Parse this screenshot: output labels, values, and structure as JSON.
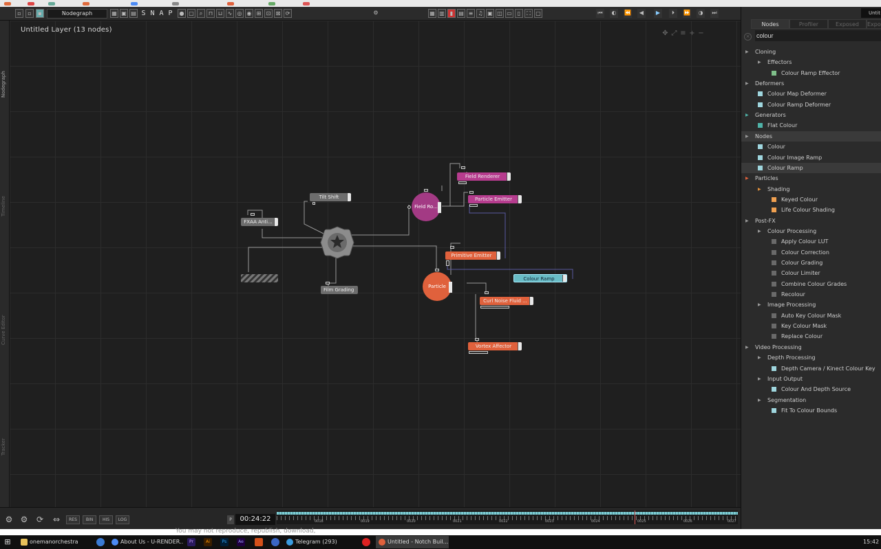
{
  "toolbar": {
    "panel_name": "Nodegraph",
    "snap_letters": [
      "S",
      "N",
      "A",
      "P"
    ]
  },
  "sidebar_tabs": {
    "nodegraph": "Nodegraph",
    "timeline": "Timeline",
    "curve_editor": "Curve Editor",
    "tracker": "Tracker"
  },
  "canvas": {
    "layer_title": "Untitled  Layer  (13  nodes)",
    "view_controls": [
      "move-icon",
      "fit-icon",
      "align-icon",
      "zoom-in-icon",
      "zoom-out-icon"
    ]
  },
  "nodes": {
    "tilt_shift": "Tilt  Shift",
    "fxaa": "FXAA  Anti...",
    "film_grading": "Film  Grading",
    "field_renderer": "Field  Renderer",
    "particle_emitter": "Particle  Emitter",
    "field_root": "Field  Ro...",
    "primitive_emitter": "Primitive  Emitter",
    "colour_ramp": "Colour  Ramp",
    "particle_root": "Particle",
    "curl_noise": "Curl  Noise  Fluid  ...",
    "vortex": "Vortex  Affector"
  },
  "right_panel": {
    "window_label": "Untit",
    "tabs": [
      "Nodes",
      "Profiler",
      "Exposed",
      "Exposed"
    ],
    "search_value": "colour",
    "tree": [
      {
        "label": "Cloning",
        "level": 0,
        "type": "group",
        "arrow_color": "#9a9a9a"
      },
      {
        "label": "Effectors",
        "level": 1,
        "type": "group",
        "arrow_color": "#9a9a9a"
      },
      {
        "label": "Colour Ramp Effector",
        "level": 2,
        "type": "item",
        "color": "#7fbf8a"
      },
      {
        "label": "Deformers",
        "level": 0,
        "type": "group",
        "arrow_color": "#9a9a9a"
      },
      {
        "label": "Colour Map Deformer",
        "level": 1,
        "type": "item",
        "color": "#9fd6de"
      },
      {
        "label": "Colour Ramp Deformer",
        "level": 1,
        "type": "item",
        "color": "#9fd6de"
      },
      {
        "label": "Generators",
        "level": 0,
        "type": "group",
        "arrow_color": "#4fb3a8"
      },
      {
        "label": "Flat Colour",
        "level": 1,
        "type": "item",
        "color": "#4fb3a8"
      },
      {
        "label": "Nodes",
        "level": 0,
        "type": "group",
        "arrow_color": "#9a9a9a",
        "selected": true
      },
      {
        "label": "Colour",
        "level": 1,
        "type": "item",
        "color": "#9fd6de"
      },
      {
        "label": "Colour Image Ramp",
        "level": 1,
        "type": "item",
        "color": "#9fd6de"
      },
      {
        "label": "Colour Ramp",
        "level": 1,
        "type": "item",
        "color": "#9fd6de",
        "selected": true
      },
      {
        "label": "Particles",
        "level": 0,
        "type": "group",
        "arrow_color": "#e0613c"
      },
      {
        "label": "Shading",
        "level": 1,
        "type": "group",
        "arrow_color": "#e0903c"
      },
      {
        "label": "Keyed Colour",
        "level": 2,
        "type": "item",
        "color": "#f0a050"
      },
      {
        "label": "Life Colour Shading",
        "level": 2,
        "type": "item",
        "color": "#f0a050"
      },
      {
        "label": "Post-FX",
        "level": 0,
        "type": "group",
        "arrow_color": "#9a9a9a"
      },
      {
        "label": "Colour Processing",
        "level": 1,
        "type": "group",
        "arrow_color": "#9a9a9a"
      },
      {
        "label": "Apply Colour LUT",
        "level": 2,
        "type": "item",
        "color": "#6a6a6a"
      },
      {
        "label": "Colour Correction",
        "level": 2,
        "type": "item",
        "color": "#6a6a6a"
      },
      {
        "label": "Colour Grading",
        "level": 2,
        "type": "item",
        "color": "#6a6a6a"
      },
      {
        "label": "Colour Limiter",
        "level": 2,
        "type": "item",
        "color": "#6a6a6a"
      },
      {
        "label": "Combine Colour Grades",
        "level": 2,
        "type": "item",
        "color": "#6a6a6a"
      },
      {
        "label": "Recolour",
        "level": 2,
        "type": "item",
        "color": "#6a6a6a"
      },
      {
        "label": "Image Processing",
        "level": 1,
        "type": "group",
        "arrow_color": "#9a9a9a"
      },
      {
        "label": "Auto Key Colour Mask",
        "level": 2,
        "type": "item",
        "color": "#6a6a6a"
      },
      {
        "label": "Key Colour Mask",
        "level": 2,
        "type": "item",
        "color": "#6a6a6a"
      },
      {
        "label": "Replace Colour",
        "level": 2,
        "type": "item",
        "color": "#6a6a6a"
      },
      {
        "label": "Video Processing",
        "level": 0,
        "type": "group",
        "arrow_color": "#9a9a9a"
      },
      {
        "label": "Depth Processing",
        "level": 1,
        "type": "group",
        "arrow_color": "#9a9a9a"
      },
      {
        "label": "Depth Camera / Kinect Colour Key",
        "level": 2,
        "type": "item",
        "color": "#9fd6de"
      },
      {
        "label": "Input Output",
        "level": 1,
        "type": "group",
        "arrow_color": "#9a9a9a"
      },
      {
        "label": "Colour And Depth Source",
        "level": 2,
        "type": "item",
        "color": "#9fd6de"
      },
      {
        "label": "Segmentation",
        "level": 1,
        "type": "group",
        "arrow_color": "#9a9a9a"
      },
      {
        "label": "Fit To Colour Bounds",
        "level": 2,
        "type": "item",
        "color": "#9fd6de"
      }
    ]
  },
  "bottombar": {
    "buttons": [
      "RES",
      "BIN",
      "HIS",
      "LOG"
    ],
    "p_label": "P",
    "timecode": "00:24:22",
    "timeline_labels": [
      "0018",
      "0019",
      "0020",
      "0021",
      "0022",
      "0023",
      "0024",
      "0025",
      "0026",
      "0027"
    ]
  },
  "watermark": "You may not reproduce, republish, download,",
  "taskbar": {
    "items": [
      {
        "label": "onemanorchestra",
        "color": "#e8c15a"
      },
      {
        "label": "About Us - U-RENDER...",
        "color": "#4c8bf5"
      },
      {
        "label": "Telegram (293)",
        "color": "#3a9be0"
      },
      {
        "label": "Untitled - Notch Buil...",
        "color": "#e0613c"
      }
    ],
    "apps": [
      "Pr",
      "Ai",
      "Ps",
      "Ae"
    ],
    "clock": "15:42"
  },
  "colors": {
    "accent_pink": "#b63c8e",
    "accent_orange": "#e0613c",
    "accent_teal": "#69bcc6"
  }
}
